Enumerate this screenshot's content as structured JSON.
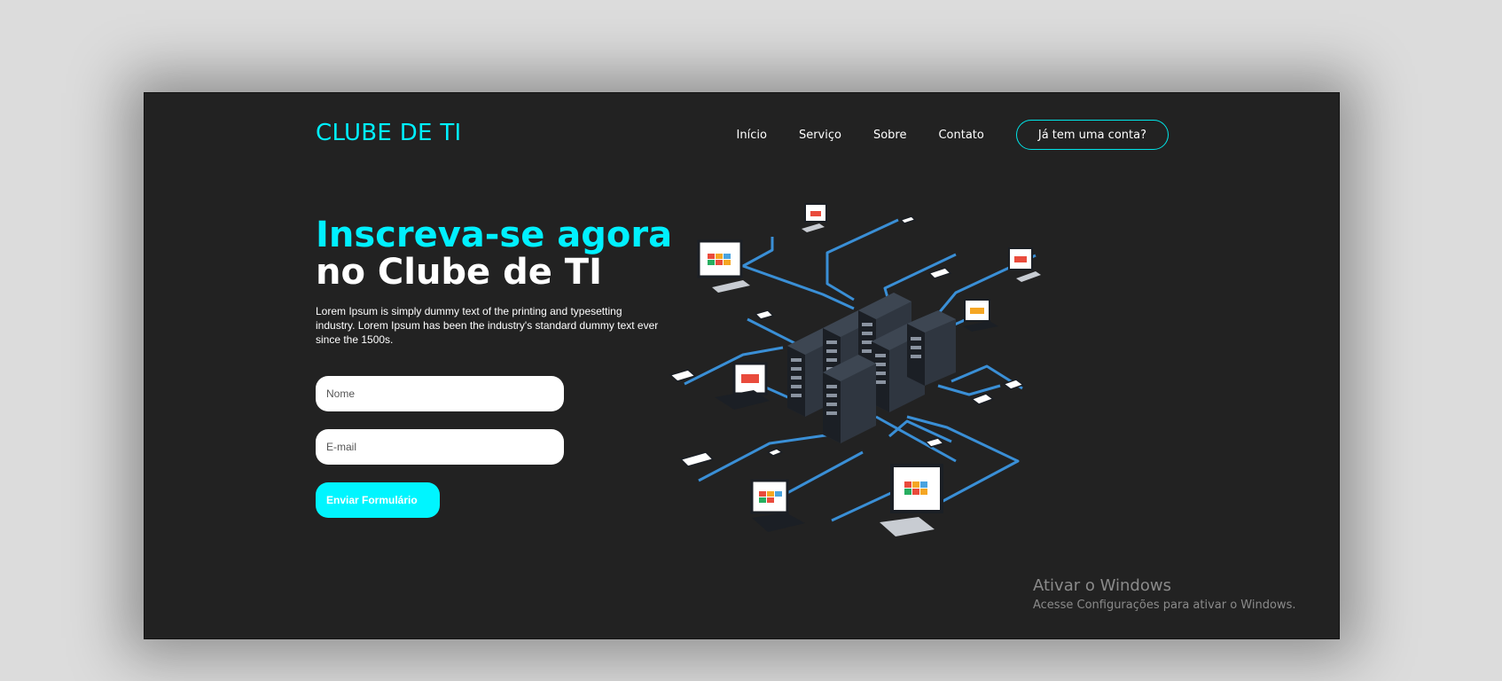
{
  "brand": {
    "logo": "CLUBE DE TI"
  },
  "nav": {
    "links": [
      "Início",
      "Serviço",
      "Sobre",
      "Contato"
    ],
    "account_button": "Já tem uma conta?"
  },
  "hero": {
    "title_line1": "Inscreva-se agora",
    "title_line2": "no Clube de TI",
    "description": "Lorem Ipsum is simply dummy text of the printing and typesetting industry. Lorem Ipsum has been the industry's standard dummy text ever since the 1500s."
  },
  "form": {
    "name_placeholder": "Nome",
    "email_placeholder": "E-mail",
    "submit_label": "Enviar Formulário"
  },
  "watermark": {
    "title": "Ativar o Windows",
    "subtitle": "Acesse Configurações para ativar o Windows."
  },
  "colors": {
    "accent": "#00f0ff",
    "background": "#222222",
    "network_line": "#3a8fd6"
  },
  "illustration": {
    "icon": "network-servers-icon"
  }
}
